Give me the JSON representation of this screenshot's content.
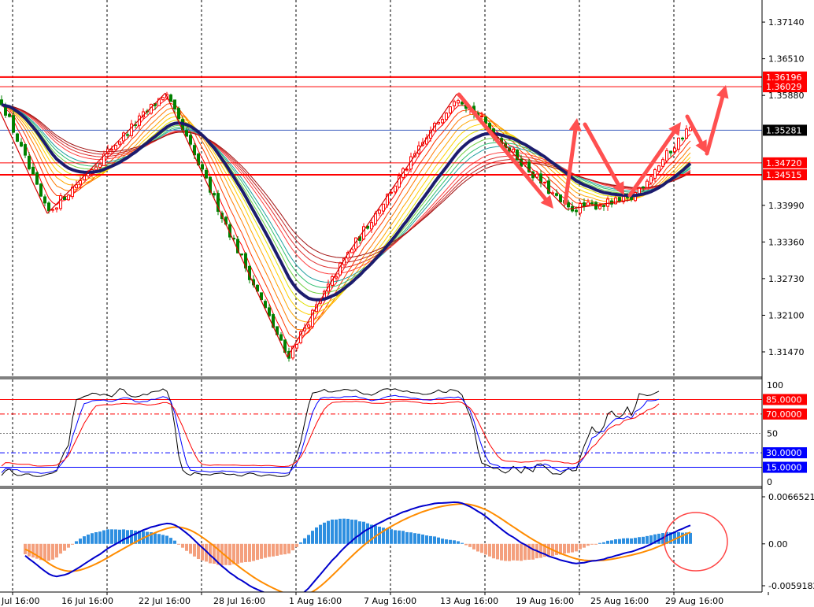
{
  "chart_data": [
    {
      "panel": "price",
      "type": "candlestick",
      "ylim": [
        1.3105,
        1.3752
      ],
      "y_ticks": [
        "1.37140",
        "1.36510",
        "1.35880",
        "1.33990",
        "1.33360",
        "1.32730",
        "1.32100",
        "1.31470"
      ],
      "levels": [
        {
          "label": "1.36196",
          "value": 1.36196,
          "color": "#ff0000"
        },
        {
          "label": "1.36029",
          "value": 1.36029,
          "color": "#ff0000"
        },
        {
          "label": "1.34720",
          "value": 1.3472,
          "color": "#ff0000"
        },
        {
          "label": "1.34515",
          "value": 1.34515,
          "color": "#ff0000"
        }
      ],
      "current_price": {
        "label": "1.35281",
        "value": 1.35281,
        "color": "#000000"
      },
      "x_ticks": [
        "Jul 16:00",
        "16 Jul 16:00",
        "22 Jul 16:00",
        "28 Jul 16:00",
        "1 Aug 16:00",
        "7 Aug 16:00",
        "13 Aug 16:00",
        "19 Aug 16:00",
        "25 Aug 16:00",
        "29 Aug 16:00"
      ],
      "path": [
        [
          0,
          1.3585
        ],
        [
          60,
          1.3385
        ],
        [
          210,
          1.3592
        ],
        [
          365,
          1.3138
        ],
        [
          440,
          1.3312
        ],
        [
          580,
          1.359
        ],
        [
          720,
          1.3392
        ],
        [
          800,
          1.3408
        ],
        [
          875,
          1.3532
        ]
      ],
      "colors": {
        "bull": "#ff0000",
        "bear": "#008000",
        "ma_slow": "#1c1c6e",
        "zigzag": "#d40000",
        "arrow": "#ff5050"
      }
    },
    {
      "panel": "oscillator",
      "type": "line",
      "ylim": [
        0,
        100
      ],
      "y_ticks": [
        "100",
        "50",
        "0"
      ],
      "levels": [
        {
          "label": "85.0000",
          "value": 85,
          "color": "#ff0000"
        },
        {
          "label": "70.0000",
          "value": 70,
          "color": "#ff0000"
        },
        {
          "label": "30.0000",
          "value": 30,
          "color": "#0000ff"
        },
        {
          "label": "15.0000",
          "value": 15,
          "color": "#0000ff"
        }
      ],
      "midline": 50
    },
    {
      "panel": "macd",
      "type": "bar",
      "ylim": [
        -0.0059182,
        0.0066521
      ],
      "y_ticks": [
        "0.0066521",
        "0.00",
        "-0.0059182"
      ],
      "colors": {
        "positive": "#2e8fe0",
        "negative": "#f4a07e",
        "line_fast": "#0000cc",
        "line_slow": "#ff8c00",
        "highlight": "#ff4444"
      }
    }
  ]
}
